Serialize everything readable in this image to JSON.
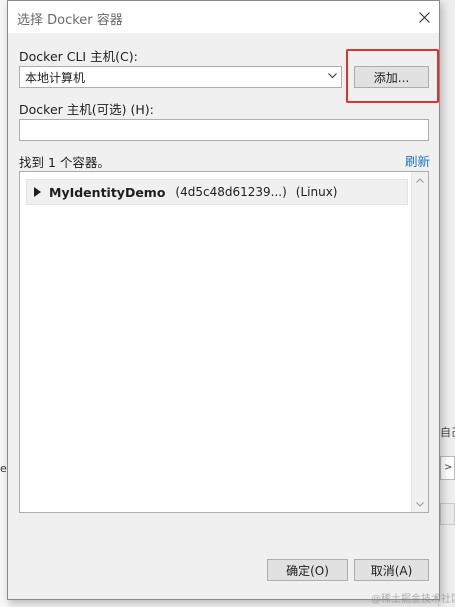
{
  "background": {
    "right_text": "自己",
    "left_text": "e"
  },
  "dialog": {
    "title": "选择 Docker 容器",
    "close_icon": "close-icon",
    "cli_host_label": "Docker CLI 主机(C):",
    "cli_host_selected": "本地计算机",
    "add_button": "添加...",
    "host_label": "Docker 主机(可选) (H):",
    "host_value": "",
    "found_text": "找到 1 个容器。",
    "refresh_link": "刷新",
    "containers": [
      {
        "name": "MyIdentityDemo",
        "id": "(4d5c48d61239...)",
        "os": "(Linux)"
      }
    ],
    "ok_button": "确定(O)",
    "cancel_button": "取消(A)"
  },
  "colors": {
    "highlight": "#e0322f",
    "link": "#1a73c9"
  },
  "watermark": "@稀土掘金技术社区"
}
